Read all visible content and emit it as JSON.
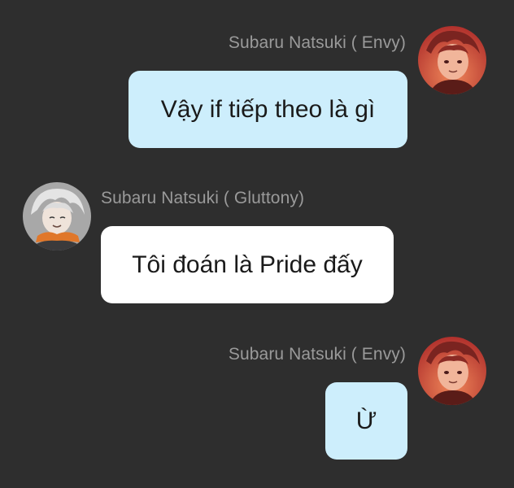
{
  "colors": {
    "background": "#2e2e2e",
    "own_bubble": "#cdeefc",
    "other_bubble": "#ffffff",
    "sender_name": "#9a9a9a"
  },
  "messages": [
    {
      "sender": "Subaru Natsuki ( Envy)",
      "text": "Vậy if tiếp theo là gì",
      "side": "right",
      "avatar_icon": "red-haired-character-avatar"
    },
    {
      "sender": "Subaru Natsuki ( Gluttony)",
      "text": "Tôi đoán là Pride đấy",
      "side": "left",
      "avatar_icon": "white-haired-character-avatar"
    },
    {
      "sender": "Subaru Natsuki ( Envy)",
      "text": "Ừ",
      "side": "right",
      "avatar_icon": "red-haired-character-avatar"
    }
  ]
}
